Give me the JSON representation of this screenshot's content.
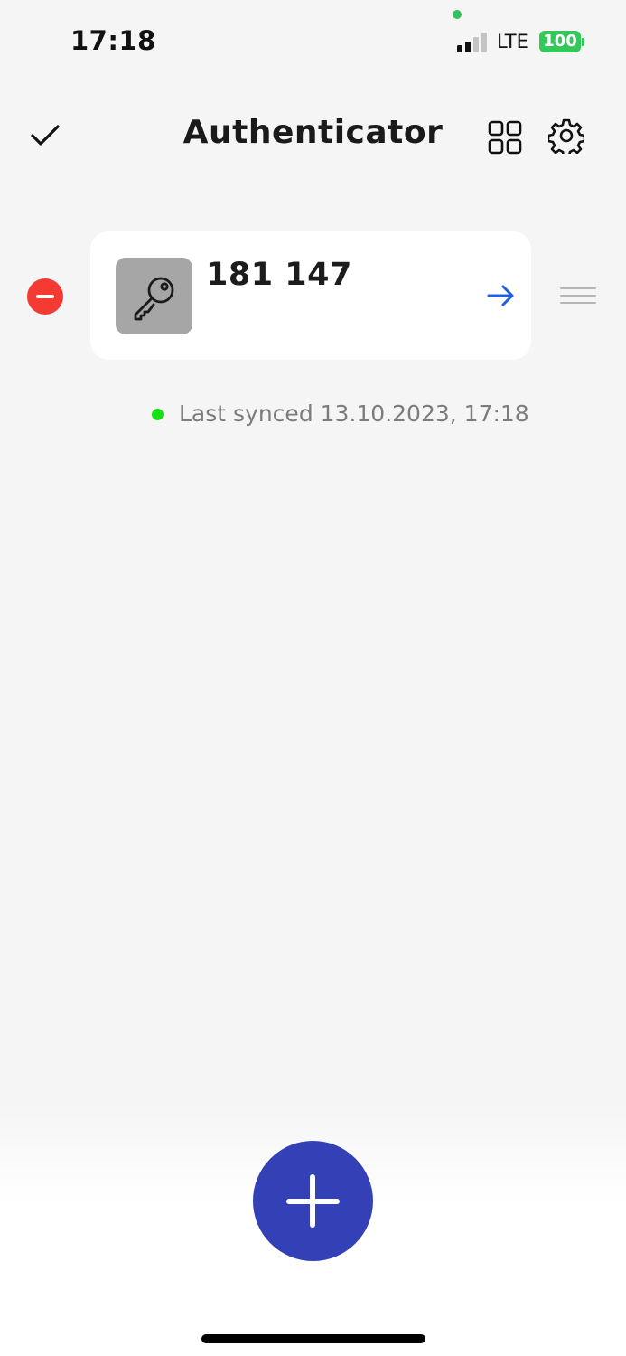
{
  "status_bar": {
    "time": "17:18",
    "network": "LTE",
    "battery": "100",
    "colors": {
      "battery": "#34c759",
      "privacy_dot": "#2fc35a"
    },
    "signal_bars_active": 2,
    "signal_bars_total": 4
  },
  "nav": {
    "title": "Authenticator",
    "icons": {
      "done": "checkmark-icon",
      "layout": "grid-icon",
      "settings": "gear-icon"
    }
  },
  "account": {
    "code": "181 147",
    "icon": "key-icon",
    "action_icon": "arrow-right-icon",
    "delete_icon": "minus-circle-icon",
    "reorder_icon": "drag-handle-icon"
  },
  "sync": {
    "text": "Last synced 13.10.2023, 17:18",
    "status_color": "#17e019"
  },
  "fab": {
    "icon": "plus-icon",
    "color": "#3340b6"
  },
  "colors": {
    "background": "#f5f5f5",
    "delete": "#f43a32",
    "accent": "#1f5fe0"
  }
}
